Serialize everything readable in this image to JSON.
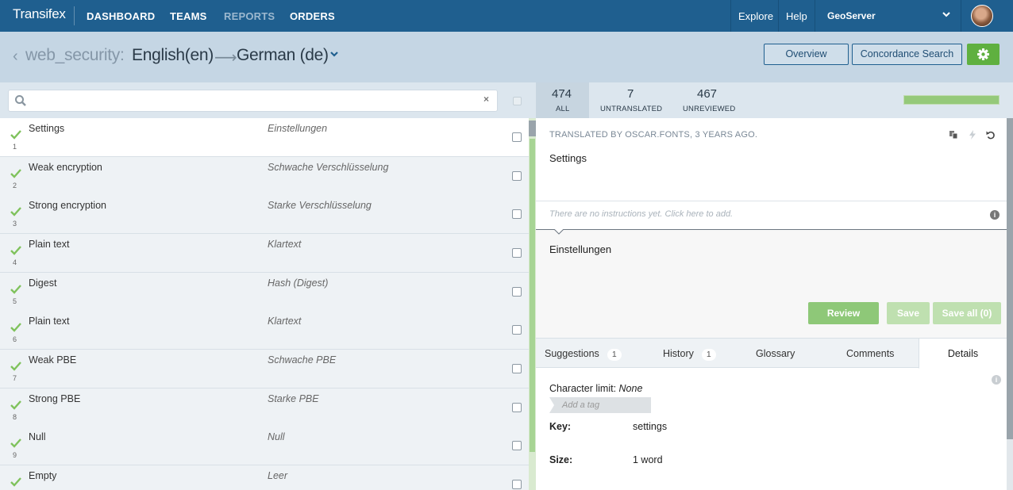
{
  "nav": {
    "logo": "Transifex",
    "links": [
      "DASHBOARD",
      "TEAMS",
      "REPORTS",
      "ORDERS"
    ],
    "explore": "Explore",
    "help": "Help",
    "org": "GeoServer"
  },
  "header": {
    "project": "web_security:",
    "source_lang": "English(en)",
    "target_lang": "German (de)",
    "overview_btn": "Overview",
    "concordance_btn": "Concordance Search"
  },
  "search": {
    "placeholder": "",
    "clear": "×"
  },
  "stats": {
    "all": {
      "value": "474",
      "label": "ALL"
    },
    "untranslated": {
      "value": "7",
      "label": "UNTRANSLATED"
    },
    "unreviewed": {
      "value": "467",
      "label": "UNREVIEWED"
    },
    "progress_fraction": 1.0,
    "progress_color": "#95c97a"
  },
  "strings": [
    {
      "num": "1",
      "source": "Settings",
      "translation": "Einstellungen"
    },
    {
      "num": "2",
      "source": "Weak encryption",
      "translation": "Schwache Verschlüsselung"
    },
    {
      "num": "3",
      "source": "Strong encryption",
      "translation": "Starke Verschlüsselung"
    },
    {
      "num": "4",
      "source": "Plain text",
      "translation": "Klartext"
    },
    {
      "num": "5",
      "source": "Digest",
      "translation": "Hash (Digest)"
    },
    {
      "num": "6",
      "source": "Plain text",
      "translation": "Klartext"
    },
    {
      "num": "7",
      "source": "Weak PBE",
      "translation": "Schwache PBE"
    },
    {
      "num": "8",
      "source": "Strong PBE",
      "translation": "Starke PBE"
    },
    {
      "num": "9",
      "source": "Null",
      "translation": "Null"
    },
    {
      "num": "",
      "source": "Empty",
      "translation": "Leer"
    }
  ],
  "detail": {
    "byline": "TRANSLATED BY OSCAR.FONTS, 3 YEARS AGO.",
    "source_text": "Settings",
    "instructions_placeholder": "There are no instructions yet. Click here to add.",
    "translation_text": "Einstellungen",
    "review_btn": "Review",
    "save_btn": "Save",
    "save_all_btn": "Save all (0)",
    "tabs": {
      "suggestions": "Suggestions",
      "suggestions_count": "1",
      "history": "History",
      "history_count": "1",
      "glossary": "Glossary",
      "comments": "Comments",
      "details": "Details"
    },
    "char_limit_label": "Character limit:",
    "char_limit_value": "None",
    "tag_placeholder": "Add a tag",
    "key_label": "Key:",
    "key_value": "settings",
    "size_label": "Size:",
    "size_value": "1 word"
  },
  "colors": {
    "nav_bg": "#1f5f8f",
    "accent_green": "#5fb040",
    "review_btn": "#8ec878",
    "disabled_btn": "#bfe0b0"
  }
}
